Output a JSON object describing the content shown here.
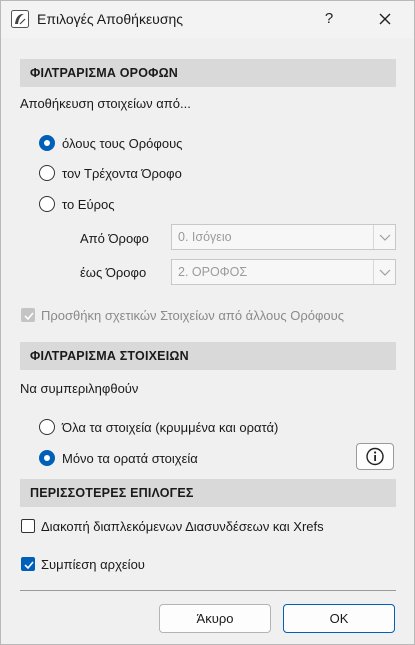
{
  "window": {
    "title": "Επιλογές Αποθήκευσης",
    "help_label": "?"
  },
  "floor_filter": {
    "header": "ΦΙΛΤΡΑΡΙΣΜΑ ΟΡΟΦΩΝ",
    "prompt": "Αποθήκευση στοιχείων από...",
    "options": [
      {
        "label": "όλους τους Ορόφους",
        "selected": true
      },
      {
        "label": "τον Τρέχοντα Όροφο",
        "selected": false
      },
      {
        "label": "το Εύρος",
        "selected": false
      }
    ],
    "from_label": "Από Όροφο",
    "from_value": "0. Ισόγειο",
    "to_label": "έως Όροφο",
    "to_value": "2. ΟΡΟΦΟΣ",
    "add_related": {
      "label": "Προσθήκη σχετικών Στοιχείων από άλλους Ορόφους",
      "checked": true,
      "disabled": true
    }
  },
  "element_filter": {
    "header": "ΦΙΛΤΡΑΡΙΣΜΑ ΣΤΟΙΧΕΙΩΝ",
    "prompt": "Να συμπεριληφθούν",
    "options": [
      {
        "label": "Όλα τα στοιχεία (κρυμμένα και ορατά)",
        "selected": false
      },
      {
        "label": "Μόνο τα ορατά στοιχεία",
        "selected": true
      }
    ]
  },
  "more_options": {
    "header": "ΠΕΡΙΣΣΟΤΕΡΕΣ ΕΠΙΛΟΓΕΣ",
    "break_links": {
      "label": "Διακοπή διαπλεκόμενων Διασυνδέσεων και Xrefs",
      "checked": false
    },
    "compress": {
      "label": "Συμπίεση αρχείου",
      "checked": true
    }
  },
  "buttons": {
    "cancel": "Άκυρο",
    "ok": "OK"
  },
  "colors": {
    "accent": "#005fb8",
    "section_bg": "#d9d9d9",
    "window_bg": "#f0f0f0"
  }
}
